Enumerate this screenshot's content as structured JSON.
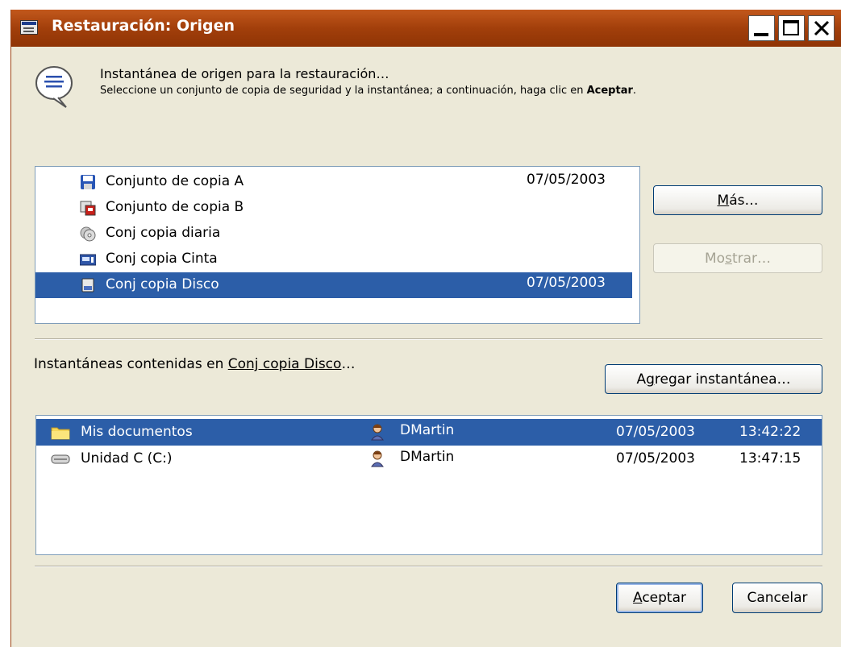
{
  "window": {
    "title": "Restauración: Origen",
    "controls": [
      "minimize-icon",
      "maximize-icon",
      "close-icon"
    ]
  },
  "header": {
    "icon": "speech-bubble-icon",
    "line1": "Instantánea de origen para la restauración…",
    "line2_prefix": "Seleccione un conjunto de copia de seguridad y la instantánea; a continuación, haga clic en ",
    "line2_bold": "Aceptar",
    "line2_suffix": "."
  },
  "backup_sets": [
    {
      "label": "Conjunto de copia A",
      "date": "07/05/2003",
      "icon": "floppy-disk-icon",
      "selected": false
    },
    {
      "label": "Conjunto de copia B",
      "date": "",
      "icon": "network-backup-icon",
      "selected": false
    },
    {
      "label": "Conj copia diaria",
      "date": "",
      "icon": "cd-disc-icon",
      "selected": false
    },
    {
      "label": "Conj copia Cinta",
      "date": "",
      "icon": "tape-drive-icon",
      "selected": false
    },
    {
      "label": "Conj copia Disco",
      "date": "07/05/2003",
      "icon": "disk-icon",
      "selected": true
    }
  ],
  "buttons": {
    "mas": {
      "pre": "",
      "ul": "M",
      "post": "ás…"
    },
    "mostrar": {
      "pre": "Mo",
      "ul": "s",
      "post": "trar…"
    },
    "agregar": {
      "pre": "A",
      "ul": "g",
      "post": "regar instantánea…"
    },
    "aceptar": {
      "pre": "",
      "ul": "A",
      "post": "ceptar"
    },
    "cancelar": "Cancelar"
  },
  "snapshots_label": {
    "prefix": "Instantáneas contenidas en ",
    "link": "Conj copia Disco",
    "suffix": "…"
  },
  "snapshots": [
    {
      "name": "Mis documentos",
      "icon": "folder-icon",
      "user": "DMartin",
      "date": "07/05/2003",
      "time": "13:42:22",
      "selected": true
    },
    {
      "name": "Unidad C (C:)",
      "icon": "hard-drive-icon",
      "user": "DMartin",
      "date": "07/05/2003",
      "time": "13:47:15",
      "selected": false
    }
  ],
  "colors": {
    "titlebar": "#a23f0b",
    "selection": "#2c5ea8",
    "dialog_bg": "#ece9d8"
  }
}
